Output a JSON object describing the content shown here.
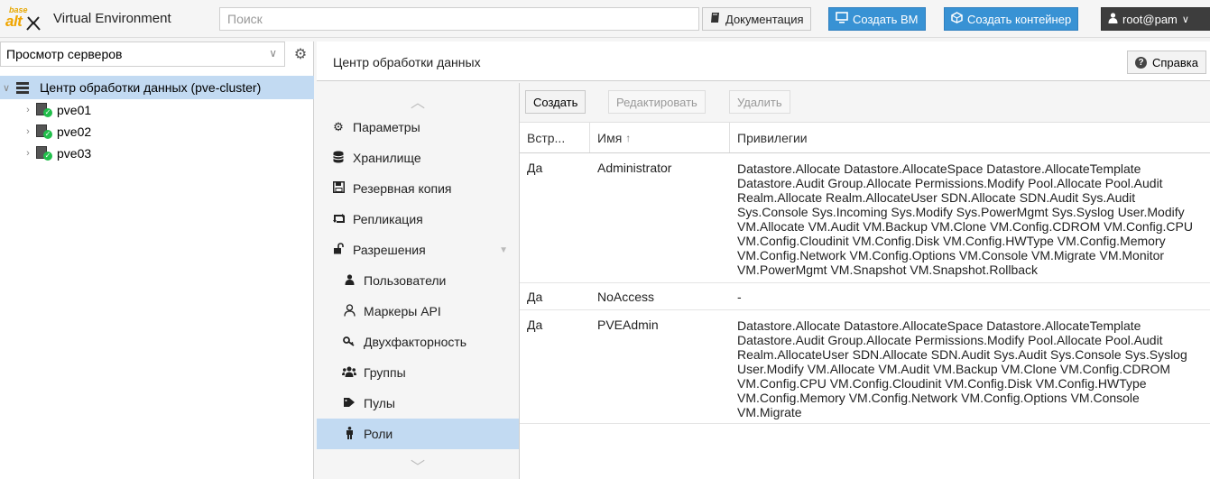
{
  "app": {
    "title": "Virtual Environment",
    "logo_base": "base",
    "logo_alt": "alt"
  },
  "search": {
    "placeholder": "Поиск"
  },
  "topbar": {
    "docs_label": "Документация",
    "create_vm_label": "Создать ВМ",
    "create_ct_label": "Создать контейнер",
    "user_label": "root@pam",
    "user_chevron": "∨"
  },
  "left": {
    "view_select_value": "Просмотр серверов",
    "tree": {
      "root_label": "Центр обработки данных (pve-cluster)",
      "nodes": [
        "pve01",
        "pve02",
        "pve03"
      ]
    }
  },
  "breadcrumb": {
    "title": "Центр обработки данных"
  },
  "help_label": "Справка",
  "nav": {
    "items": [
      {
        "label": "Параметры",
        "icon": "gear-icon"
      },
      {
        "label": "Хранилище",
        "icon": "database-icon"
      },
      {
        "label": "Резервная копия",
        "icon": "floppy-icon"
      },
      {
        "label": "Репликация",
        "icon": "retweet-icon"
      },
      {
        "label": "Разрешения",
        "icon": "unlock-icon"
      },
      {
        "label": "Пользователи",
        "icon": "user-icon"
      },
      {
        "label": "Маркеры API",
        "icon": "user-outline-icon"
      },
      {
        "label": "Двухфакторность",
        "icon": "key-icon"
      },
      {
        "label": "Группы",
        "icon": "users-icon"
      },
      {
        "label": "Пулы",
        "icon": "tags-icon"
      },
      {
        "label": "Роли",
        "icon": "male-icon"
      }
    ]
  },
  "toolbar": {
    "create_label": "Создать",
    "edit_label": "Редактировать",
    "delete_label": "Удалить"
  },
  "grid": {
    "columns": [
      "Встр...",
      "Имя",
      "Привилегии"
    ],
    "sort_indicator": "↑",
    "rows": [
      {
        "builtin": "Да",
        "name": "Administrator",
        "privileges": "Datastore.Allocate Datastore.AllocateSpace Datastore.AllocateTemplate Datastore.Audit Group.Allocate Permissions.Modify Pool.Allocate Pool.Audit Realm.Allocate Realm.AllocateUser SDN.Allocate SDN.Audit Sys.Audit Sys.Console Sys.Incoming Sys.Modify Sys.PowerMgmt Sys.Syslog User.Modify VM.Allocate VM.Audit VM.Backup VM.Clone VM.Config.CDROM VM.Config.CPU VM.Config.Cloudinit VM.Config.Disk VM.Config.HWType VM.Config.Memory VM.Config.Network VM.Config.Options VM.Console VM.Migrate VM.Monitor VM.PowerMgmt VM.Snapshot VM.Snapshot.Rollback"
      },
      {
        "builtin": "Да",
        "name": "NoAccess",
        "privileges": "-"
      },
      {
        "builtin": "Да",
        "name": "PVEAdmin",
        "privileges": "Datastore.Allocate Datastore.AllocateSpace Datastore.AllocateTemplate Datastore.Audit Group.Allocate Permissions.Modify Pool.Allocate Pool.Audit Realm.AllocateUser SDN.Allocate SDN.Audit Sys.Audit Sys.Console Sys.Syslog User.Modify VM.Allocate VM.Audit VM.Backup VM.Clone VM.Config.CDROM VM.Config.CPU VM.Config.Cloudinit VM.Config.Disk VM.Config.HWType VM.Config.Memory VM.Config.Network VM.Config.Options VM.Console VM.Migrate"
      }
    ]
  },
  "colors": {
    "accent_blue": "#3892d4",
    "selection": "#c2daf2",
    "status_green": "#21bf4b",
    "logo_orange": "#f0a500"
  }
}
